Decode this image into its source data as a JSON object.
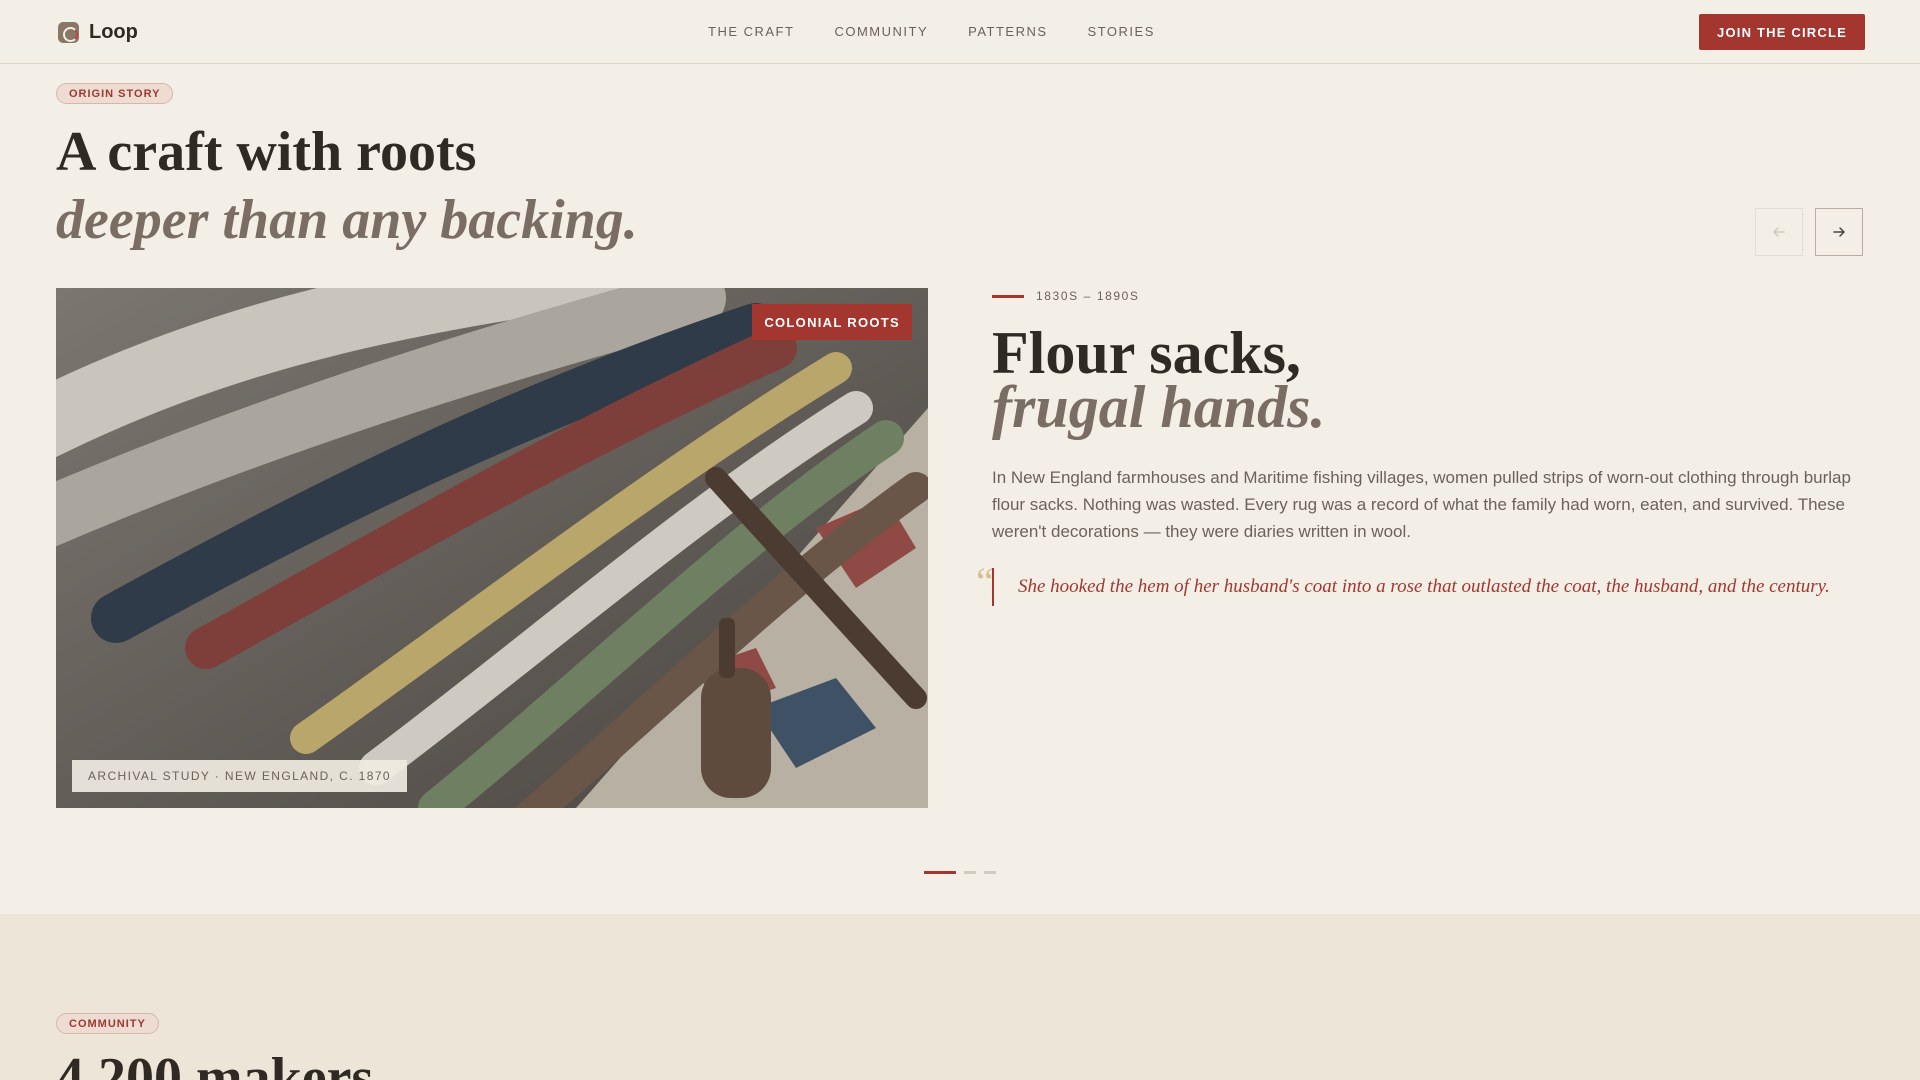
{
  "brand": {
    "name": "Loop",
    "logo_icon": "loop-logo-icon"
  },
  "nav": {
    "items": [
      "THE CRAFT",
      "COMMUNITY",
      "PATTERNS",
      "STORIES"
    ],
    "cta_label": "JOIN THE CIRCLE"
  },
  "hero": {
    "eyebrow": "ORIGIN STORY",
    "title_line1": "A craft with roots",
    "title_line2": "deeper than any backing.",
    "prev_icon": "arrow-left-icon",
    "next_icon": "arrow-right-icon"
  },
  "slide": {
    "image_badge": "COLONIAL ROOTS",
    "image_caption": "ARCHIVAL STUDY · NEW ENGLAND, C. 1870",
    "era": "1830S – 1890S",
    "title_line1": "Flour sacks,",
    "title_line2": "frugal hands.",
    "body": "In New England farmhouses and Maritime fishing villages, women pulled strips of worn-out clothing through burlap flour sacks. Nothing was wasted. Every rug was a record of what the family had worn, eaten, and survived. These weren't decorations — they were diaries written in wool.",
    "quote": "She hooked the hem of her husband's coat into a rose that outlasted the coat, the husband, and the century.",
    "quote_icon": "quote-mark-icon"
  },
  "pager": {
    "count": 3,
    "active_index": 0
  },
  "community": {
    "eyebrow": "COMMUNITY",
    "title": "4,200 makers"
  },
  "colors": {
    "background": "#f4efe6",
    "accent": "#a3362f",
    "section_bg": "#ede5d8"
  }
}
